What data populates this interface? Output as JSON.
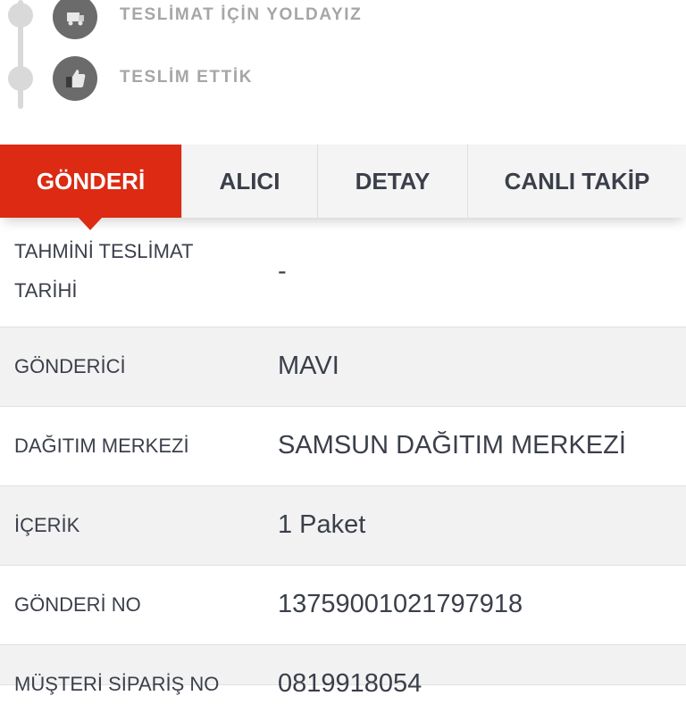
{
  "timeline": {
    "steps": [
      {
        "label": "TESLİMAT İÇİN YOLDAYIZ",
        "icon": "delivery-truck-icon"
      },
      {
        "label": "TESLİM ETTİK",
        "icon": "thumbs-up-icon"
      }
    ]
  },
  "tabs": [
    {
      "label": "GÖNDERİ",
      "active": true
    },
    {
      "label": "ALICI",
      "active": false
    },
    {
      "label": "DETAY",
      "active": false
    },
    {
      "label": "CANLI TAKİP",
      "active": false
    }
  ],
  "details": [
    {
      "label": "TAHMİNİ TESLİMAT TARİHİ",
      "value": "-"
    },
    {
      "label": "GÖNDERİCİ",
      "value": "MAVI"
    },
    {
      "label": "DAĞITIM MERKEZİ",
      "value": "SAMSUN DAĞITIM MERKEZİ"
    },
    {
      "label": "İÇERİK",
      "value": "1 Paket"
    },
    {
      "label": "GÖNDERİ NO",
      "value": "13759001021797918"
    },
    {
      "label": "MÜŞTERİ SİPARİŞ NO",
      "value": "0819918054"
    }
  ],
  "colors": {
    "accent": "#dc2a13",
    "text": "#3b3f4a",
    "muted": "#a6a6a6"
  }
}
